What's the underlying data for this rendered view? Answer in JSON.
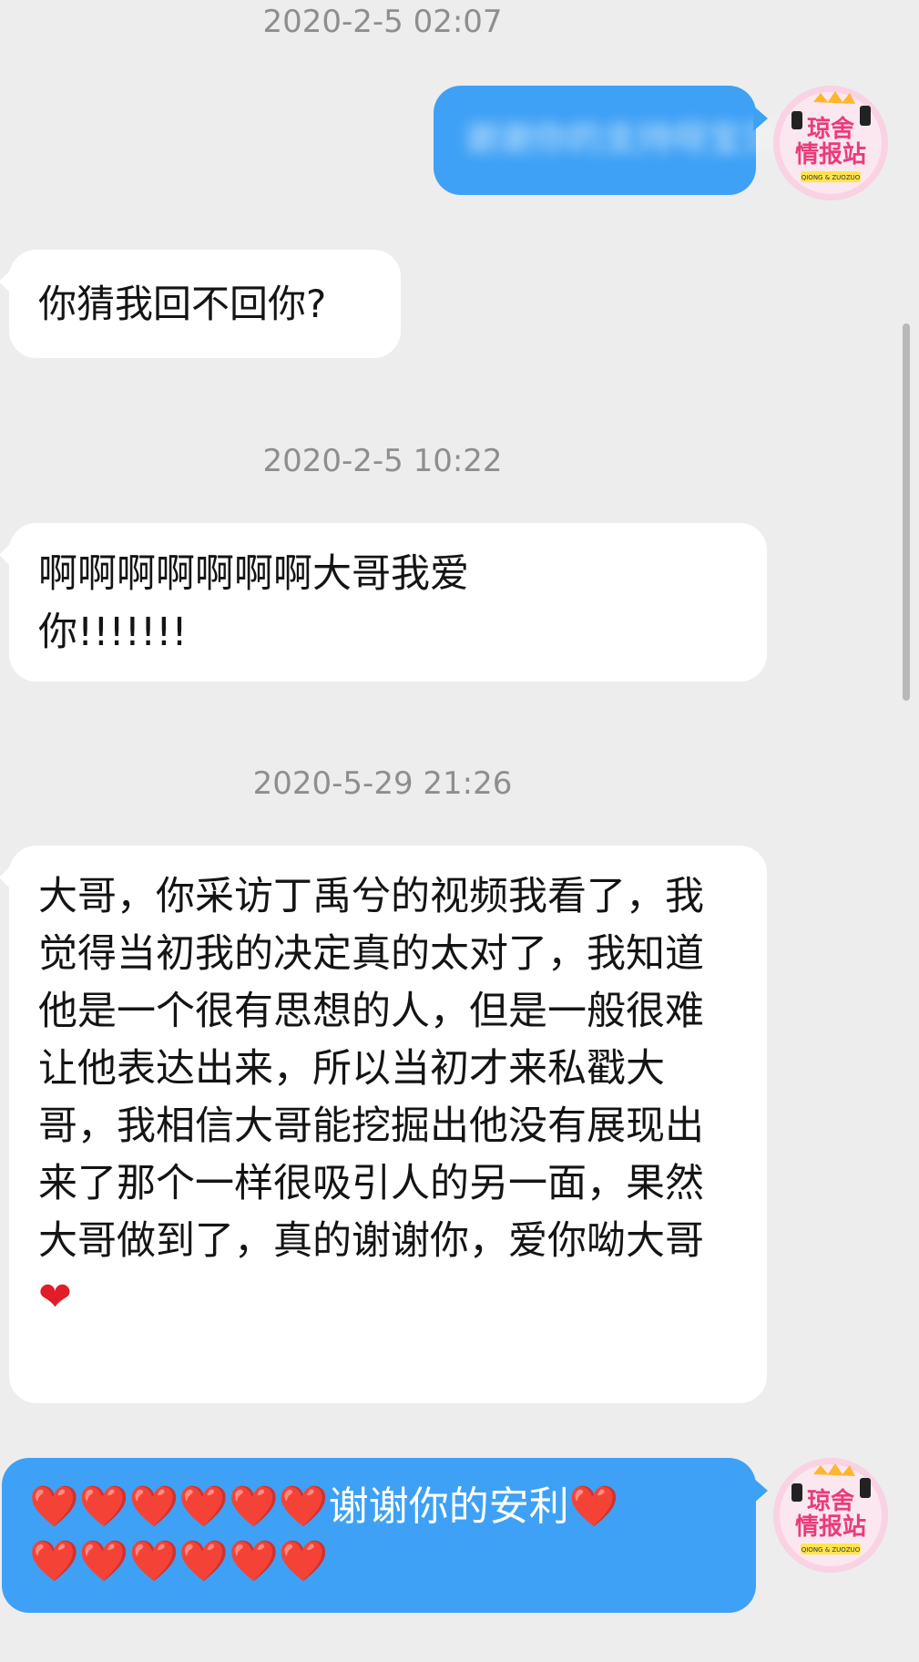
{
  "chat": {
    "timestamps": [
      "2020-2-5 02:07",
      "2020-2-5 10:22",
      "2020-5-29 21:26"
    ],
    "messages": [
      {
        "side": "right",
        "type": "blurred",
        "text": "谢谢你的支持呀宝贝i"
      },
      {
        "side": "left",
        "text": "你猜我回不回你?"
      },
      {
        "side": "left",
        "text": "啊啊啊啊啊啊啊大哥我爱你!!!!!!!"
      },
      {
        "side": "left",
        "text": "大哥，你采访丁禹兮的视频我看了，我觉得当初我的决定真的太对了，我知道他是一个很有思想的人，但是一般很难让他表达出来，所以当初才来私戳大哥，我相信大哥能挖掘出他没有展现出来了那个一样很吸引人的另一面，果然大哥做到了，真的谢谢你，爱你呦大哥"
      },
      {
        "side": "right",
        "heart_line_1": "❤️❤️❤️❤️❤️❤️",
        "text": "谢谢你的安利",
        "heart_line_1_tail": "❤️",
        "heart_line_2": "❤️❤️❤️❤️❤️❤️"
      }
    ],
    "avatar": {
      "line1": "琼舍",
      "line2": "情报站",
      "badge": "QIONG & ZUOZUO"
    }
  }
}
